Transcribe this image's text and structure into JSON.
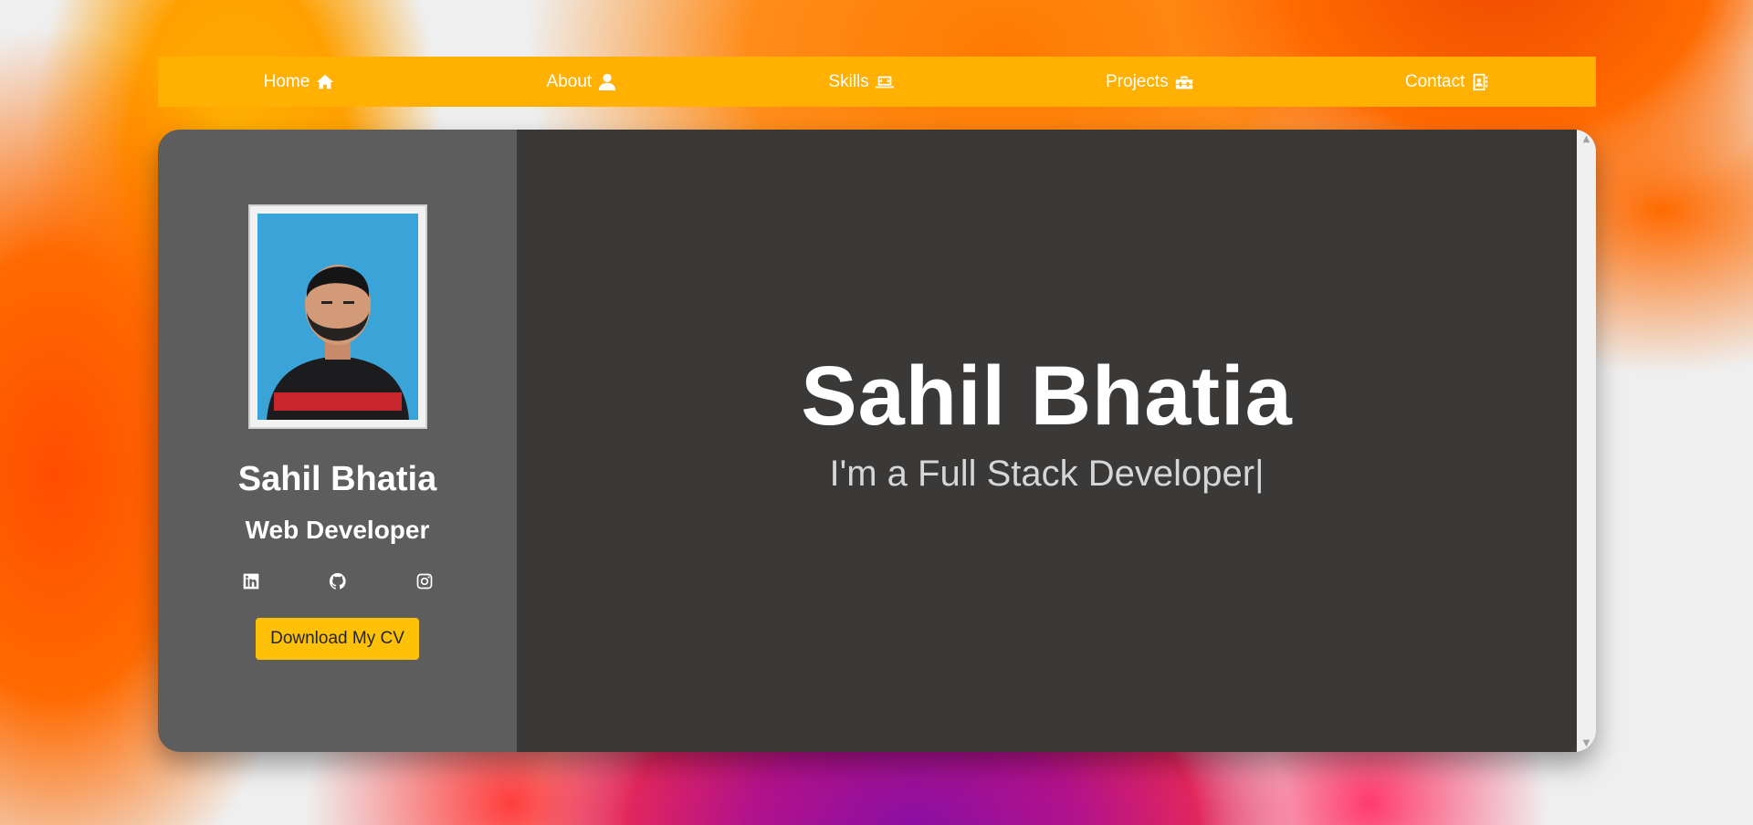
{
  "nav": {
    "items": [
      {
        "label": "Home",
        "icon": "home-icon"
      },
      {
        "label": "About",
        "icon": "user-icon"
      },
      {
        "label": "Skills",
        "icon": "laptop-code-icon"
      },
      {
        "label": "Projects",
        "icon": "toolbox-icon"
      },
      {
        "label": "Contact",
        "icon": "address-book-icon"
      }
    ],
    "bg_color": "#ffb000"
  },
  "sidebar": {
    "name": "Sahil Bhatia",
    "role": "Web Developer",
    "socials": [
      "linkedin-icon",
      "github-icon",
      "instagram-icon"
    ],
    "cv_button": "Download My CV"
  },
  "hero": {
    "name": "Sahil Bhatia",
    "tagline": "I'm a Full Stack Developer|"
  },
  "colors": {
    "accent": "#ffc107",
    "sidebar_bg": "#5e5d5d",
    "content_bg": "#3a3938"
  }
}
